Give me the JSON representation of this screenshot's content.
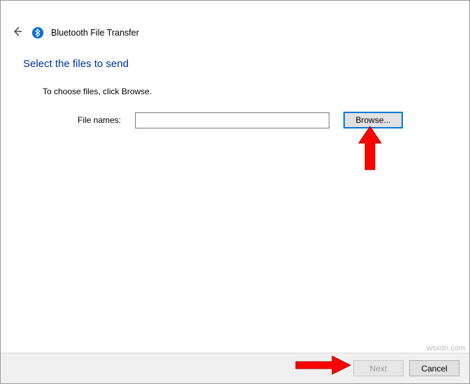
{
  "window": {
    "title": "Bluetooth File Transfer"
  },
  "content": {
    "heading": "Select the files to send",
    "instruction": "To choose files, click Browse.",
    "file_label": "File names:",
    "file_value": "",
    "browse_label": "Browse..."
  },
  "footer": {
    "next_label": "Next",
    "cancel_label": "Cancel"
  },
  "watermark": "wsxdn.com"
}
